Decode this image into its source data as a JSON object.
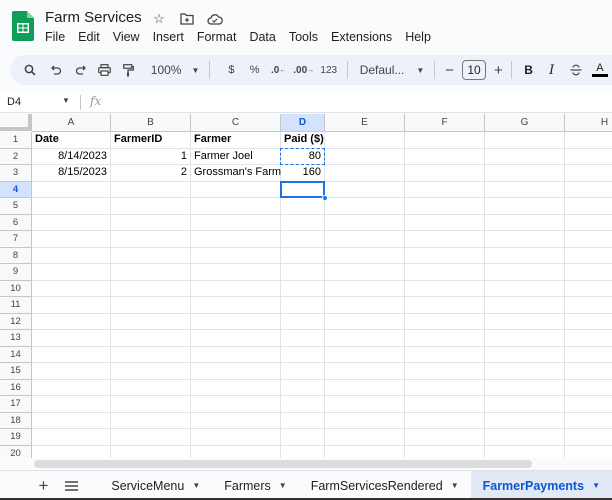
{
  "app": {
    "title": "Farm Services",
    "accent": "#0b57d0",
    "brand_green": "#0f9d58"
  },
  "menu": [
    "File",
    "Edit",
    "View",
    "Insert",
    "Format",
    "Data",
    "Tools",
    "Extensions",
    "Help"
  ],
  "toolbar": {
    "zoom": "100%",
    "currency": "$",
    "percent": "%",
    "dec_decrease": ".0",
    "dec_increase": ".00",
    "number_format": "123",
    "font": "Defaul...",
    "font_size": "10",
    "minus": "−",
    "plus": "+",
    "bold": "B",
    "italic": "I",
    "text_color": "A"
  },
  "formula_bar": {
    "name_box": "D4",
    "fx": "fx",
    "value": ""
  },
  "columns": [
    "A",
    "B",
    "C",
    "D",
    "E",
    "F",
    "G",
    "H"
  ],
  "rows": [
    "1",
    "2",
    "3",
    "4",
    "5",
    "6",
    "7",
    "8",
    "9",
    "10",
    "11",
    "12",
    "13",
    "14",
    "15",
    "16",
    "17",
    "18",
    "19",
    "20"
  ],
  "cells": {
    "A1": "Date",
    "B1": "FarmerID",
    "C1": "Farmer",
    "D1": "Paid ($)",
    "A2": "8/14/2023",
    "B2": "1",
    "C2": "Farmer Joel",
    "D2": "80",
    "A3": "8/15/2023",
    "B3": "2",
    "C3": "Grossman's Farm",
    "D3": "160"
  },
  "selection": {
    "active_cell": "D4",
    "copied_cell": "D2"
  },
  "sheets": {
    "tabs": [
      "ServiceMenu",
      "Farmers",
      "FarmServicesRendered",
      "FarmerPayments"
    ],
    "active": "FarmerPayments"
  }
}
